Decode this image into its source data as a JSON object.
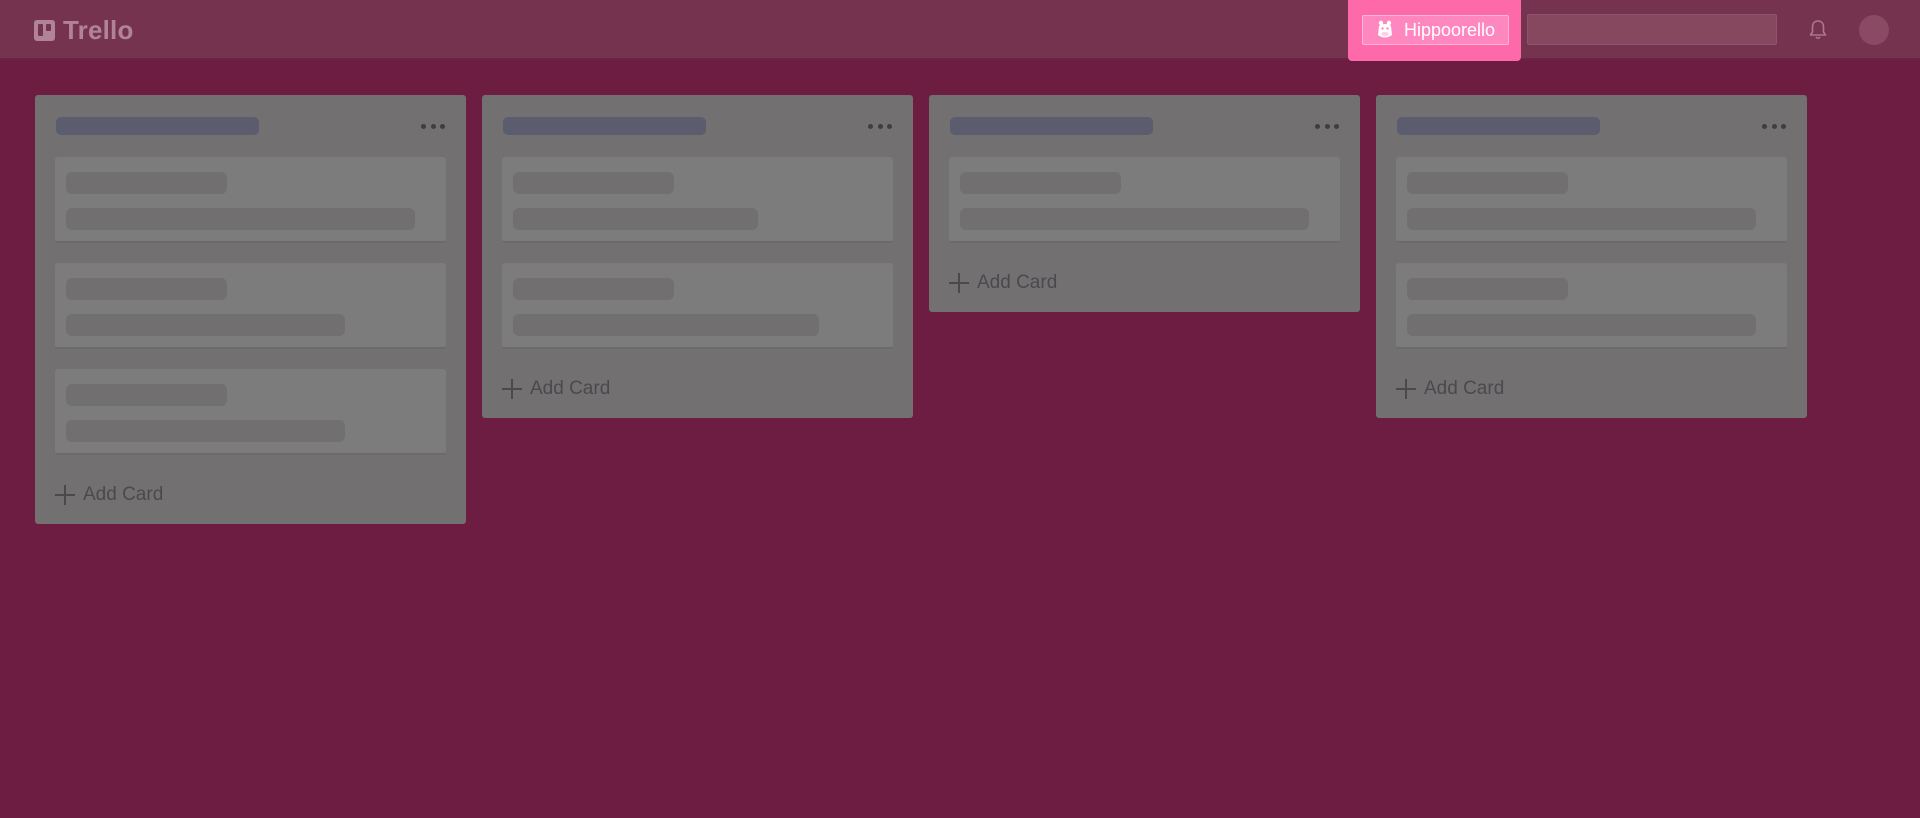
{
  "app": {
    "logo_text": "Trello"
  },
  "header": {
    "hippo_button_label": "Hippoorello",
    "search_placeholder": "",
    "colors": {
      "header_bg": "#75334f",
      "page_bg": "#6d1c42",
      "hippo_bg": "#fe6aa9"
    }
  },
  "lists": [
    {
      "add_card_label": "Add Card",
      "cards": [
        {},
        {},
        {}
      ]
    },
    {
      "add_card_label": "Add Card",
      "cards": [
        {},
        {}
      ]
    },
    {
      "add_card_label": "Add Card",
      "cards": [
        {}
      ]
    },
    {
      "add_card_label": "Add Card",
      "cards": [
        {},
        {}
      ]
    }
  ],
  "icons": {
    "logo": "trello-logo-icon",
    "hippo": "hippo-icon",
    "notifications": "bell-icon",
    "list_menu": "more-horizontal-icon",
    "add": "plus-icon"
  }
}
